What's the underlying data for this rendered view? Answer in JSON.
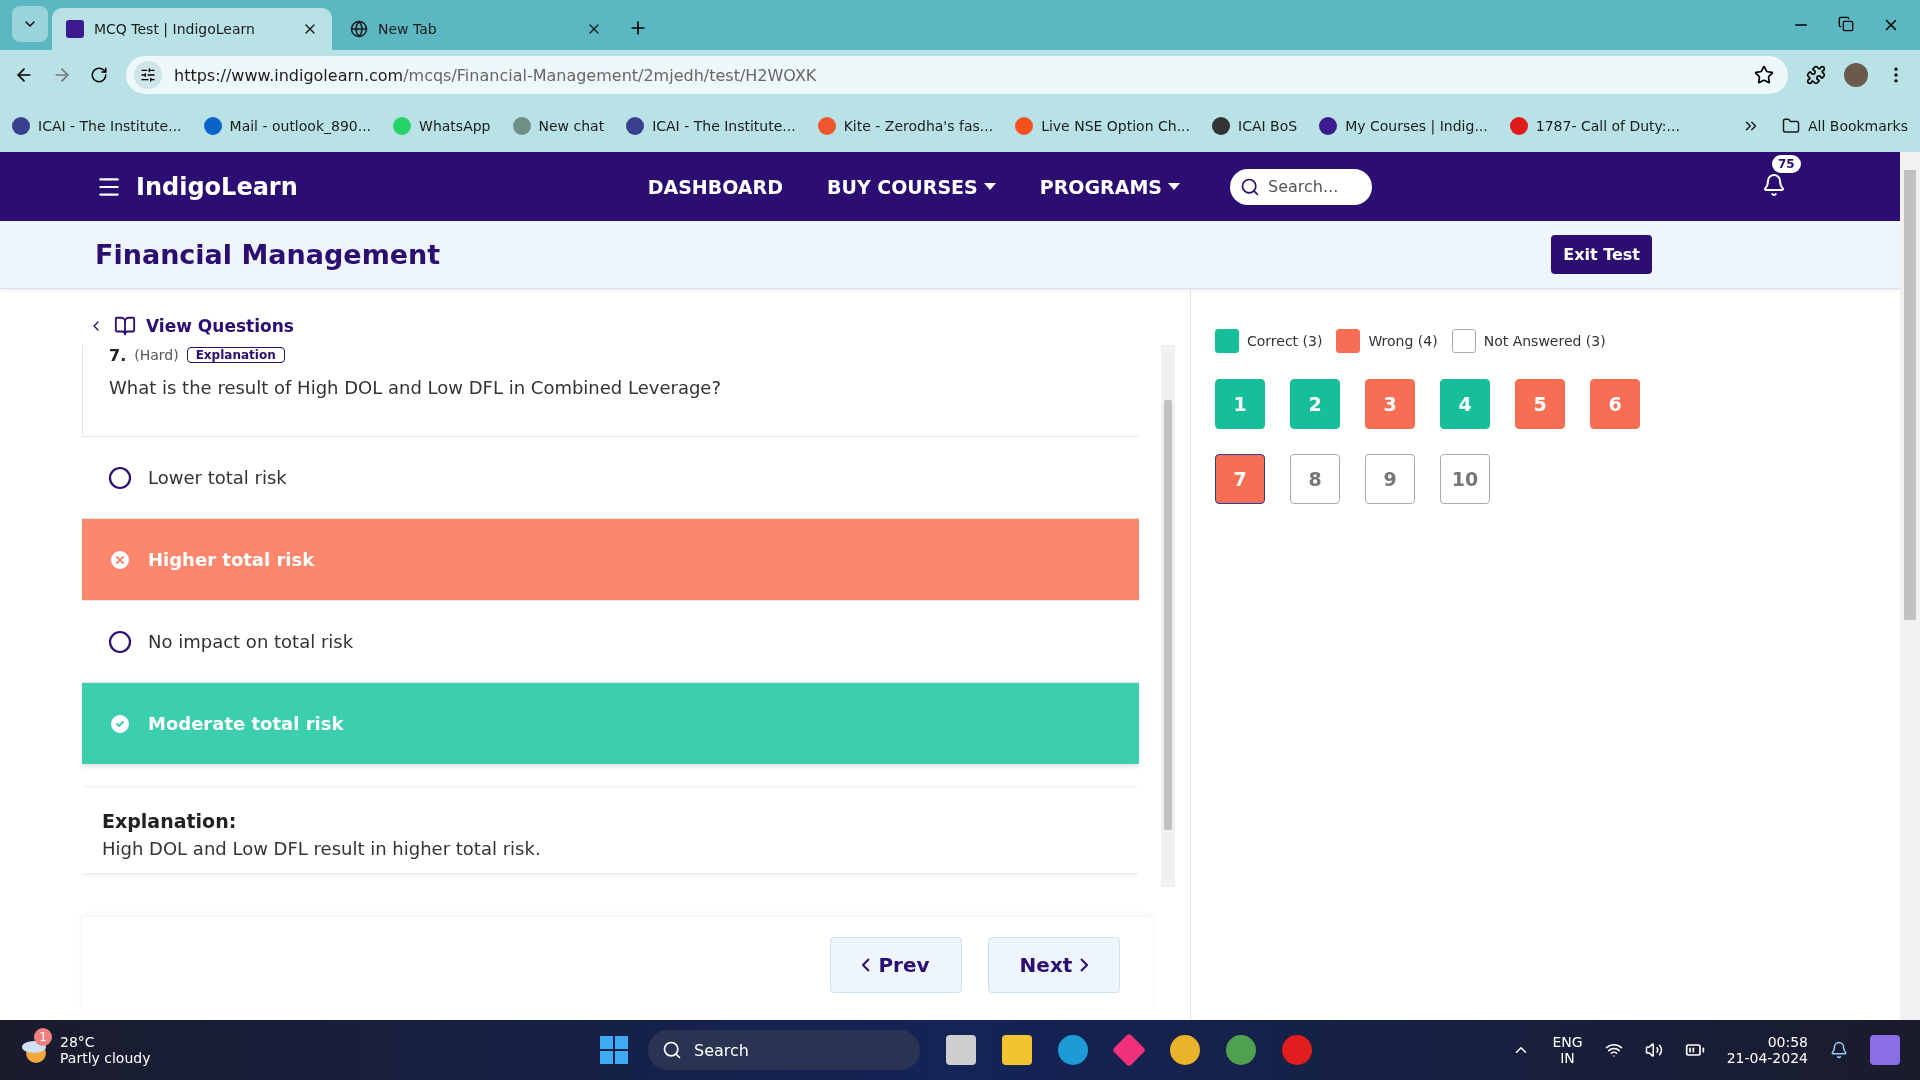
{
  "browser": {
    "tabs": [
      {
        "title": "MCQ Test | IndigoLearn",
        "selected": true
      },
      {
        "title": "New Tab",
        "selected": false
      }
    ],
    "url": {
      "host": "https://www.indigolearn.com",
      "path": "/mcqs/Financial-Management/2mjedh/test/H2WOXK"
    },
    "bookmarks": [
      {
        "label": "ICAI - The Institute...",
        "color": "#3a3f8f"
      },
      {
        "label": "Mail - outlook_890...",
        "color": "#0a64c8"
      },
      {
        "label": "WhatsApp",
        "color": "#25d366"
      },
      {
        "label": "New chat",
        "color": "#6e8f86"
      },
      {
        "label": "ICAI - The Institute...",
        "color": "#3a3f8f"
      },
      {
        "label": "Kite - Zerodha's fas...",
        "color": "#f0562e"
      },
      {
        "label": "Live NSE Option Ch...",
        "color": "#f4511e"
      },
      {
        "label": "ICAI BoS",
        "color": "#333333"
      },
      {
        "label": "My Courses | Indig...",
        "color": "#3d1a8f"
      },
      {
        "label": "1787- Call of Duty:...",
        "color": "#e01b1b"
      }
    ],
    "all_bookmarks": "All Bookmarks"
  },
  "app": {
    "brand": "IndigoLearn",
    "nav": [
      {
        "label": "DASHBOARD",
        "dropdown": false
      },
      {
        "label": "BUY COURSES",
        "dropdown": true
      },
      {
        "label": "PROGRAMS",
        "dropdown": true
      }
    ],
    "search_placeholder": "Search...",
    "notifications": "75"
  },
  "subheader": {
    "title": "Financial Management",
    "exit": "Exit Test"
  },
  "view_questions": "View Questions",
  "question": {
    "number": "7.",
    "difficulty": "(Hard)",
    "tag": "Explanation",
    "text": "What is the result of High DOL and Low DFL in Combined Leverage?",
    "options": [
      {
        "text": "Lower total risk",
        "kind": "plain"
      },
      {
        "text": "Higher total risk",
        "kind": "wrong"
      },
      {
        "text": "No impact on total risk",
        "kind": "plain"
      },
      {
        "text": "Moderate total risk",
        "kind": "correct"
      }
    ]
  },
  "explanation": {
    "heading": "Explanation:",
    "text": "High DOL and Low DFL result in higher total risk."
  },
  "nav_buttons": {
    "prev": "Prev",
    "next": "Next"
  },
  "legend": [
    {
      "label": "Correct (3)",
      "kind": "correct"
    },
    {
      "label": "Wrong (4)",
      "kind": "wrong"
    },
    {
      "label": "Not Answered (3)",
      "kind": "unanswered"
    }
  ],
  "palette": [
    {
      "label": "1",
      "kind": "correct",
      "selected": false
    },
    {
      "label": "2",
      "kind": "correct",
      "selected": false
    },
    {
      "label": "3",
      "kind": "wrong",
      "selected": false
    },
    {
      "label": "4",
      "kind": "correct",
      "selected": false
    },
    {
      "label": "5",
      "kind": "wrong",
      "selected": false
    },
    {
      "label": "6",
      "kind": "wrong",
      "selected": false
    },
    {
      "label": "7",
      "kind": "wrong",
      "selected": true
    },
    {
      "label": "8",
      "kind": "unanswered",
      "selected": false
    },
    {
      "label": "9",
      "kind": "unanswered",
      "selected": false
    },
    {
      "label": "10",
      "kind": "unanswered",
      "selected": false
    }
  ],
  "taskbar": {
    "weather_badge": "1",
    "temperature": "28°C",
    "condition": "Partly cloudy",
    "search": "Search",
    "lang": "ENG",
    "region": "IN",
    "time": "00:58",
    "date": "21-04-2024"
  }
}
